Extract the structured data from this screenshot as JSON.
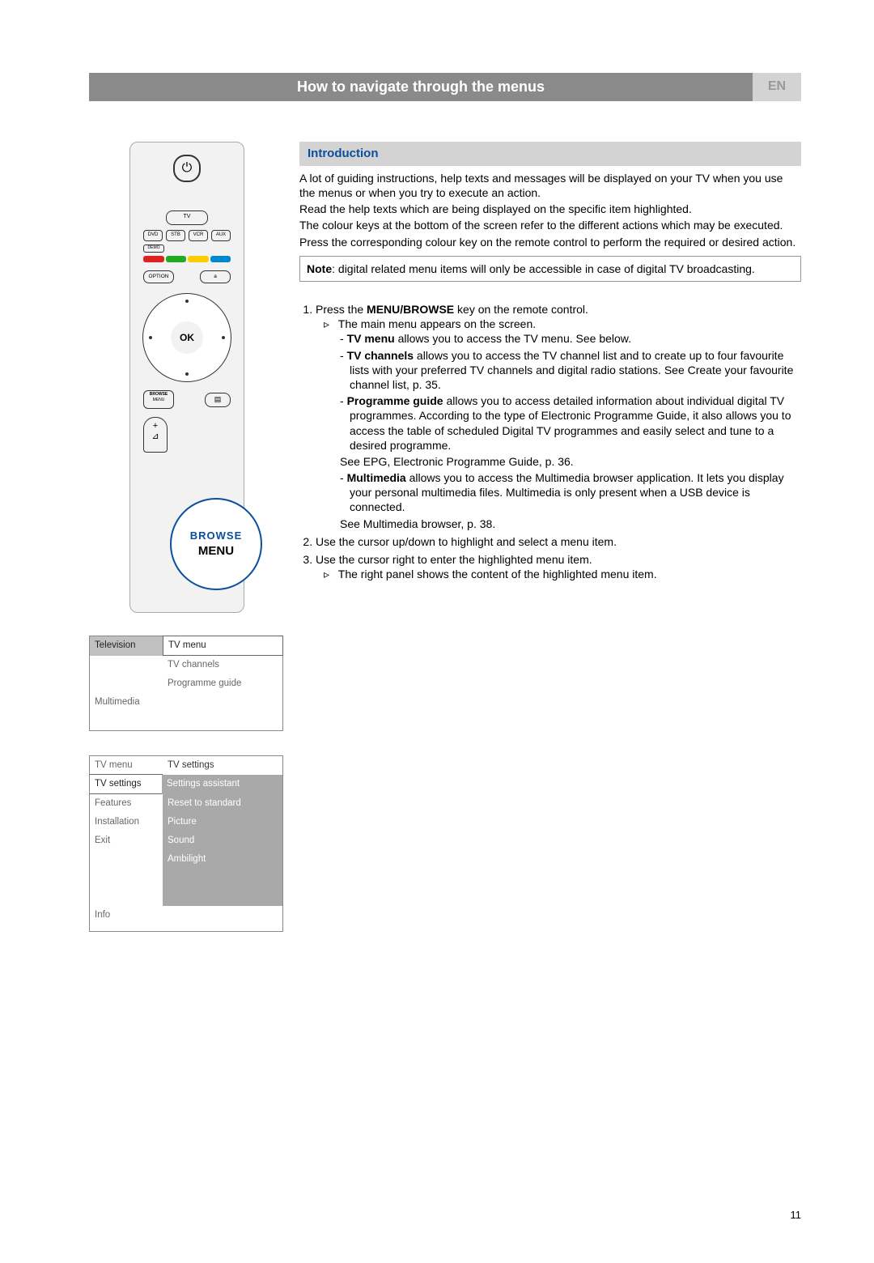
{
  "header": {
    "title": "How to navigate through the menus",
    "lang": "EN"
  },
  "section_intro_heading": "Introduction",
  "intro": {
    "p1": "A lot of guiding instructions, help texts and messages will be displayed on your TV when you use the menus or when you try to execute an action.",
    "p2": "Read the help texts which are being displayed on the specific item highlighted.",
    "p3": "The colour keys at the bottom of the screen refer to the different actions which may be executed.",
    "p4": "Press the corresponding colour key on the remote control to perform the required or desired action."
  },
  "note": {
    "label": "Note",
    "text": ": digital related menu items will only be accessible in case of digital TV broadcasting."
  },
  "steps": {
    "s1": {
      "lead_a": "Press the ",
      "key": "MENU/BROWSE",
      "lead_b": " key on the remote control.",
      "sub": "The main menu appears on the screen.",
      "tv_menu_b": "TV menu",
      "tv_menu_t": " allows you to access the TV menu. See below.",
      "tv_ch_b": "TV channels",
      "tv_ch_t": " allows you to access the TV channel list and to create up to four favourite lists with your preferred TV channels and digital radio stations. See Create your favourite channel list, p. 35.",
      "pg_b": "Programme guide",
      "pg_t": " allows you to access detailed information about individual digital TV programmes. According to the type of Electronic Programme Guide, it also allows you to access the table of scheduled Digital TV programmes and easily select and tune to a desired programme.",
      "pg_see": "See EPG, Electronic Programme Guide, p. 36.",
      "mm_b": "Multimedia",
      "mm_t": " allows you to access the Multimedia browser application. It lets you display your personal multimedia files. Multimedia is only present when a USB device is connected.",
      "mm_see": "See Multimedia browser, p. 38."
    },
    "s2": "Use the cursor up/down to highlight and select a menu item.",
    "s3": {
      "lead": "Use the cursor right to enter the highlighted menu item.",
      "sub": "The right panel shows the content of the highlighted menu item."
    }
  },
  "osd1": {
    "left1": "Television",
    "right1": "TV menu",
    "right2": "TV channels",
    "right3": "Programme guide",
    "left4": "Multimedia"
  },
  "osd2": {
    "head_left": "TV menu",
    "head_right": "TV settings",
    "l1": "TV settings",
    "r1": "Settings assistant",
    "l2": "Features",
    "r2": "Reset to standard",
    "l3": "Installation",
    "r3": "Picture",
    "l4": "Exit",
    "r4": "Sound",
    "r5": "Ambilight",
    "info": "Info"
  },
  "remote": {
    "tv": "TV",
    "modes": {
      "dvd": "DVD",
      "stb": "STB",
      "vcr": "VCR",
      "aux": "AUX"
    },
    "demo": "DEMO",
    "option": "OPTION",
    "a": "a",
    "ok": "OK",
    "browse": "BROWSE",
    "menu": "MENU",
    "callout_browse": "BROWSE",
    "callout_menu": "MENU",
    "plus": "+",
    "angle": "⊿"
  },
  "page_number": "11"
}
